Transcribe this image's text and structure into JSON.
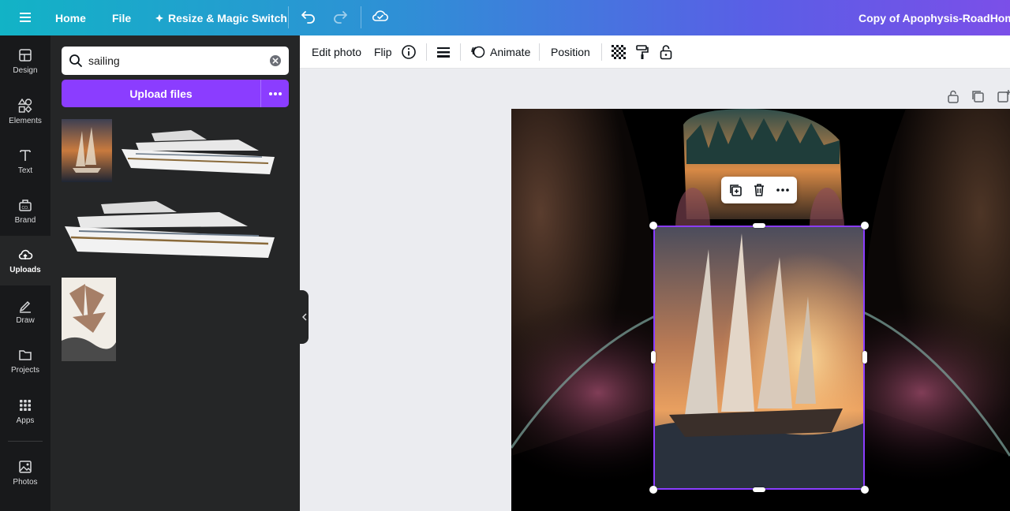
{
  "topbar": {
    "home_label": "Home",
    "file_label": "File",
    "resize_label": "Resize & Magic Switch",
    "doc_title": "Copy of Apophysis-RoadHomeTo"
  },
  "rail": {
    "items": [
      {
        "label": "Design",
        "icon": "design-icon"
      },
      {
        "label": "Elements",
        "icon": "elements-icon"
      },
      {
        "label": "Text",
        "icon": "text-icon"
      },
      {
        "label": "Brand",
        "icon": "brand-icon"
      },
      {
        "label": "Uploads",
        "icon": "upload-cloud-icon",
        "active": true
      },
      {
        "label": "Draw",
        "icon": "draw-icon"
      },
      {
        "label": "Projects",
        "icon": "folder-icon"
      },
      {
        "label": "Apps",
        "icon": "apps-grid-icon"
      },
      {
        "label": "Photos",
        "icon": "photo-icon"
      }
    ]
  },
  "panel": {
    "search_value": "sailing",
    "upload_label": "Upload files",
    "thumbnails": [
      "sailing ship at sunset",
      "cruise ship",
      "cruise ship",
      "sailing ship sketch"
    ]
  },
  "context_toolbar": {
    "edit_photo": "Edit photo",
    "flip": "Flip",
    "animate": "Animate",
    "position": "Position"
  },
  "colors": {
    "accent": "#8b3dff",
    "rail_bg": "#18191b",
    "panel_bg": "#252627",
    "canvas_bg": "#ebecf0"
  }
}
